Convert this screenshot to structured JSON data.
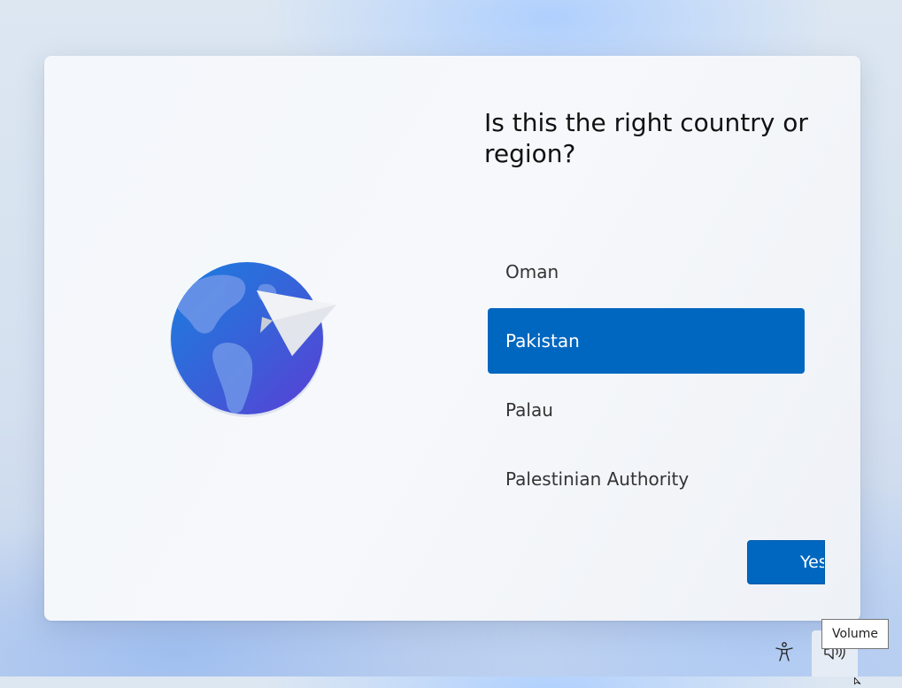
{
  "setup": {
    "heading": "Is this the right country or region?",
    "regions": [
      {
        "label": "Oman",
        "selected": false
      },
      {
        "label": "Pakistan",
        "selected": true
      },
      {
        "label": "Palau",
        "selected": false
      },
      {
        "label": "Palestinian Authority",
        "selected": false
      }
    ],
    "confirm_label": "Yes",
    "hero_icon": "globe-paper-plane-icon"
  },
  "tray": {
    "accessibility_icon": "accessibility-icon",
    "volume_icon": "volume-icon",
    "tooltip": "Volume"
  },
  "colors": {
    "accent": "#0067c0",
    "card": "#f4f7fb"
  }
}
